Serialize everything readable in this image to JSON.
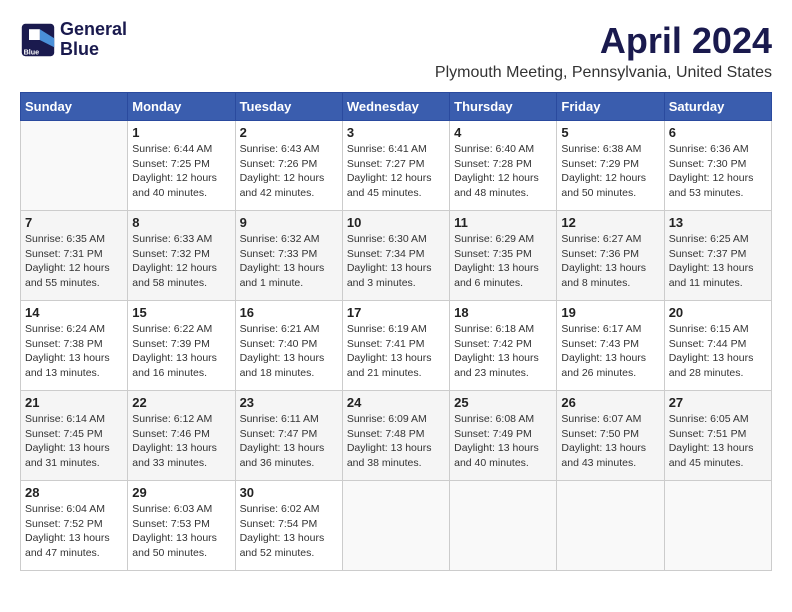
{
  "header": {
    "logo_line1": "General",
    "logo_line2": "Blue",
    "month_year": "April 2024",
    "location": "Plymouth Meeting, Pennsylvania, United States"
  },
  "days_of_week": [
    "Sunday",
    "Monday",
    "Tuesday",
    "Wednesday",
    "Thursday",
    "Friday",
    "Saturday"
  ],
  "weeks": [
    [
      {
        "day": "",
        "info": ""
      },
      {
        "day": "1",
        "info": "Sunrise: 6:44 AM\nSunset: 7:25 PM\nDaylight: 12 hours\nand 40 minutes."
      },
      {
        "day": "2",
        "info": "Sunrise: 6:43 AM\nSunset: 7:26 PM\nDaylight: 12 hours\nand 42 minutes."
      },
      {
        "day": "3",
        "info": "Sunrise: 6:41 AM\nSunset: 7:27 PM\nDaylight: 12 hours\nand 45 minutes."
      },
      {
        "day": "4",
        "info": "Sunrise: 6:40 AM\nSunset: 7:28 PM\nDaylight: 12 hours\nand 48 minutes."
      },
      {
        "day": "5",
        "info": "Sunrise: 6:38 AM\nSunset: 7:29 PM\nDaylight: 12 hours\nand 50 minutes."
      },
      {
        "day": "6",
        "info": "Sunrise: 6:36 AM\nSunset: 7:30 PM\nDaylight: 12 hours\nand 53 minutes."
      }
    ],
    [
      {
        "day": "7",
        "info": "Sunrise: 6:35 AM\nSunset: 7:31 PM\nDaylight: 12 hours\nand 55 minutes."
      },
      {
        "day": "8",
        "info": "Sunrise: 6:33 AM\nSunset: 7:32 PM\nDaylight: 12 hours\nand 58 minutes."
      },
      {
        "day": "9",
        "info": "Sunrise: 6:32 AM\nSunset: 7:33 PM\nDaylight: 13 hours\nand 1 minute."
      },
      {
        "day": "10",
        "info": "Sunrise: 6:30 AM\nSunset: 7:34 PM\nDaylight: 13 hours\nand 3 minutes."
      },
      {
        "day": "11",
        "info": "Sunrise: 6:29 AM\nSunset: 7:35 PM\nDaylight: 13 hours\nand 6 minutes."
      },
      {
        "day": "12",
        "info": "Sunrise: 6:27 AM\nSunset: 7:36 PM\nDaylight: 13 hours\nand 8 minutes."
      },
      {
        "day": "13",
        "info": "Sunrise: 6:25 AM\nSunset: 7:37 PM\nDaylight: 13 hours\nand 11 minutes."
      }
    ],
    [
      {
        "day": "14",
        "info": "Sunrise: 6:24 AM\nSunset: 7:38 PM\nDaylight: 13 hours\nand 13 minutes."
      },
      {
        "day": "15",
        "info": "Sunrise: 6:22 AM\nSunset: 7:39 PM\nDaylight: 13 hours\nand 16 minutes."
      },
      {
        "day": "16",
        "info": "Sunrise: 6:21 AM\nSunset: 7:40 PM\nDaylight: 13 hours\nand 18 minutes."
      },
      {
        "day": "17",
        "info": "Sunrise: 6:19 AM\nSunset: 7:41 PM\nDaylight: 13 hours\nand 21 minutes."
      },
      {
        "day": "18",
        "info": "Sunrise: 6:18 AM\nSunset: 7:42 PM\nDaylight: 13 hours\nand 23 minutes."
      },
      {
        "day": "19",
        "info": "Sunrise: 6:17 AM\nSunset: 7:43 PM\nDaylight: 13 hours\nand 26 minutes."
      },
      {
        "day": "20",
        "info": "Sunrise: 6:15 AM\nSunset: 7:44 PM\nDaylight: 13 hours\nand 28 minutes."
      }
    ],
    [
      {
        "day": "21",
        "info": "Sunrise: 6:14 AM\nSunset: 7:45 PM\nDaylight: 13 hours\nand 31 minutes."
      },
      {
        "day": "22",
        "info": "Sunrise: 6:12 AM\nSunset: 7:46 PM\nDaylight: 13 hours\nand 33 minutes."
      },
      {
        "day": "23",
        "info": "Sunrise: 6:11 AM\nSunset: 7:47 PM\nDaylight: 13 hours\nand 36 minutes."
      },
      {
        "day": "24",
        "info": "Sunrise: 6:09 AM\nSunset: 7:48 PM\nDaylight: 13 hours\nand 38 minutes."
      },
      {
        "day": "25",
        "info": "Sunrise: 6:08 AM\nSunset: 7:49 PM\nDaylight: 13 hours\nand 40 minutes."
      },
      {
        "day": "26",
        "info": "Sunrise: 6:07 AM\nSunset: 7:50 PM\nDaylight: 13 hours\nand 43 minutes."
      },
      {
        "day": "27",
        "info": "Sunrise: 6:05 AM\nSunset: 7:51 PM\nDaylight: 13 hours\nand 45 minutes."
      }
    ],
    [
      {
        "day": "28",
        "info": "Sunrise: 6:04 AM\nSunset: 7:52 PM\nDaylight: 13 hours\nand 47 minutes."
      },
      {
        "day": "29",
        "info": "Sunrise: 6:03 AM\nSunset: 7:53 PM\nDaylight: 13 hours\nand 50 minutes."
      },
      {
        "day": "30",
        "info": "Sunrise: 6:02 AM\nSunset: 7:54 PM\nDaylight: 13 hours\nand 52 minutes."
      },
      {
        "day": "",
        "info": ""
      },
      {
        "day": "",
        "info": ""
      },
      {
        "day": "",
        "info": ""
      },
      {
        "day": "",
        "info": ""
      }
    ]
  ]
}
